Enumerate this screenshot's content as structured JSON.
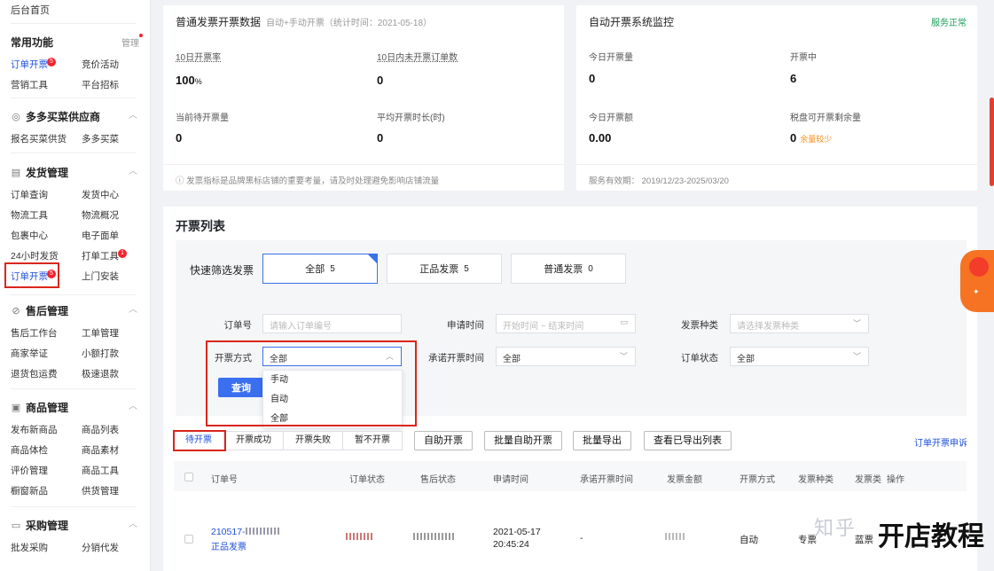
{
  "sidebar": {
    "home": "后台首页",
    "common": {
      "title": "常用功能",
      "manage": "管理",
      "items": [
        "订单开票",
        "竞价活动",
        "营销工具",
        "平台招标"
      ],
      "badge": "5"
    },
    "supply": {
      "title": "多多买菜供应商",
      "items": [
        "报名买菜供货",
        "多多买菜"
      ]
    },
    "shipping": {
      "title": "发货管理",
      "items": [
        "订单查询",
        "发货中心",
        "物流工具",
        "物流概况",
        "包裹中心",
        "电子面单",
        "24小时发货",
        "打单工具",
        "订单开票",
        "上门安装"
      ],
      "badge_print": "1",
      "badge_invoice": "5"
    },
    "aftersale": {
      "title": "售后管理",
      "items": [
        "售后工作台",
        "工单管理",
        "商家举证",
        "小额打款",
        "退货包运费",
        "极速退款"
      ]
    },
    "goods": {
      "title": "商品管理",
      "items": [
        "发布新商品",
        "商品列表",
        "商品体检",
        "商品素材",
        "评价管理",
        "商品工具",
        "橱窗新品",
        "供货管理"
      ]
    },
    "purchase": {
      "title": "采购管理",
      "items": [
        "批发采购",
        "分销代发"
      ]
    }
  },
  "card1": {
    "title": "普通发票开票数据",
    "subtitle": "自动+手动开票（统计时间：2021-05-18）",
    "stats": [
      {
        "label": "10日开票率",
        "value": "100",
        "unit": "%"
      },
      {
        "label": "10日内未开票订单数",
        "value": "0"
      },
      {
        "label": "当前待开票量",
        "value": "0"
      },
      {
        "label": "平均开票时长(时)",
        "value": "0"
      }
    ],
    "footer": "ⓘ 发票指标是品牌黑标店铺的重要考量，请及时处理避免影响店铺流量"
  },
  "card2": {
    "title": "自动开票系统监控",
    "status": "服务正常",
    "stats": [
      {
        "label": "今日开票量",
        "value": "0"
      },
      {
        "label": "开票中",
        "value": "6"
      },
      {
        "label": "今日开票额",
        "value": "0.00"
      },
      {
        "label": "税盘可开票剩余量",
        "value": "0",
        "warn": "余量较少"
      }
    ],
    "footer": "服务有效期：  2019/12/23-2025/03/20"
  },
  "list": {
    "title": "开票列表",
    "quick_label": "快速筛选发票",
    "quick_tabs": [
      {
        "label": "全部",
        "n": "5"
      },
      {
        "label": "正品发票",
        "n": "5"
      },
      {
        "label": "普通发票",
        "n": "0"
      }
    ],
    "f_order": "订单号",
    "f_order_ph": "请输入订单编号",
    "f_apply": "申请时间",
    "f_apply_ph": "开始时间  ~  结束时间",
    "f_kind": "发票种类",
    "f_kind_ph": "请选择发票种类",
    "f_method": "开票方式",
    "f_method_val": "全部",
    "f_promise": "承诺开票时间",
    "f_promise_val": "全部",
    "f_status": "订单状态",
    "f_status_val": "全部",
    "dropdown": [
      "手动",
      "自动",
      "全部"
    ],
    "query": "查询",
    "tabs": [
      "待开票",
      "开票成功",
      "开票失败",
      "暂不开票"
    ],
    "actions": [
      "自助开票",
      "批量自助开票",
      "批量导出",
      "查看已导出列表"
    ],
    "appeal": "订单开票申诉",
    "columns": [
      "订单号",
      "订单状态",
      "售后状态",
      "申请时间",
      "承诺开票时间",
      "发票金额",
      "开票方式",
      "发票种类",
      "发票类",
      "操作"
    ],
    "row": {
      "order": "210517-",
      "order_tag": "正品发票",
      "date": "2021-05-17",
      "time": "20:45:24",
      "promise": "-",
      "method": "自动",
      "kind": "专票",
      "type": "蓝票"
    }
  },
  "watermark": {
    "zhihu": "知乎",
    "brand": "开店教程"
  }
}
